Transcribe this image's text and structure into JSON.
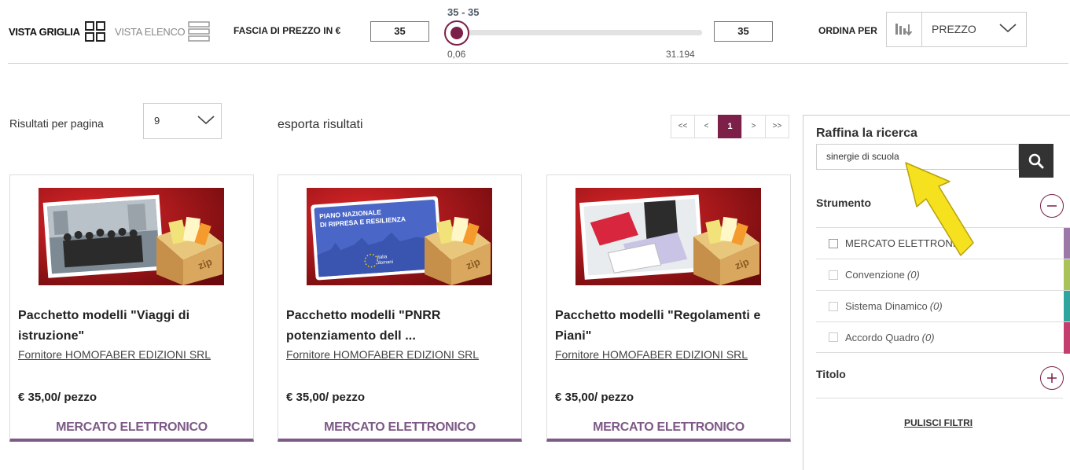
{
  "toolbar": {
    "grid_view_label": "VISTA GRIGLIA",
    "list_view_label": "VISTA ELENCO",
    "price_range_label": "FASCIA DI PREZZO IN €",
    "price_min_value": "35",
    "price_max_value": "35",
    "slider_range_text": "35 - 35",
    "slider_min_text": "0,06",
    "slider_max_text": "31.194",
    "slider_value_fraction": 0,
    "order_label": "ORDINA PER",
    "order_value": "PREZZO"
  },
  "results": {
    "per_page_label": "Risultati per pagina",
    "per_page_value": "9",
    "export_label": "esporta risultati",
    "pager": [
      "<<",
      "<",
      "1",
      ">",
      ">>"
    ],
    "current_page": "1"
  },
  "cards": [
    {
      "title": "Pacchetto modelli \"Viaggi di istruzione\"",
      "supplier": "Fornitore HOMOFABER EDIZIONI SRL",
      "price": "€ 35,00/ pezzo",
      "channel": "MERCATO ELETTRONICO"
    },
    {
      "title": "Pacchetto modelli \"PNRR potenziamento dell ...",
      "supplier": "Fornitore HOMOFABER EDIZIONI SRL",
      "price": "€ 35,00/ pezzo",
      "channel": "MERCATO ELETTRONICO",
      "banner_line1": "PIANO NAZIONALE",
      "banner_line2": "DI RIPRESA E RESILIENZA",
      "logo_line1": "italia",
      "logo_line2": "domani",
      "zip_text": "zip"
    },
    {
      "title": "Pacchetto modelli \"Regolamenti e Piani\"",
      "supplier": "Fornitore HOMOFABER EDIZIONI SRL",
      "price": "€ 35,00/ pezzo",
      "channel": "MERCATO ELETTRONICO"
    }
  ],
  "refine": {
    "title": "Raffina la ricerca",
    "search_value": "sinergie di scuola",
    "strumento_label": "Strumento",
    "facets": [
      {
        "label": "MERCATO ELETTRONICO",
        "count": "",
        "color": "#9b78a8"
      },
      {
        "label": "Convenzione",
        "count": "(0)",
        "color": "#a9c25a"
      },
      {
        "label": "Sistema Dinamico",
        "count": "(0)",
        "color": "#2fa59d"
      },
      {
        "label": "Accordo Quadro",
        "count": "(0)",
        "color": "#c33e6e"
      }
    ],
    "titolo_label": "Titolo",
    "clear_label": "PULISCI FILTRI"
  },
  "colors": {
    "accent": "#7d2049",
    "channel": "#7d5a86",
    "highlight_arrow": "#f5e11d"
  }
}
